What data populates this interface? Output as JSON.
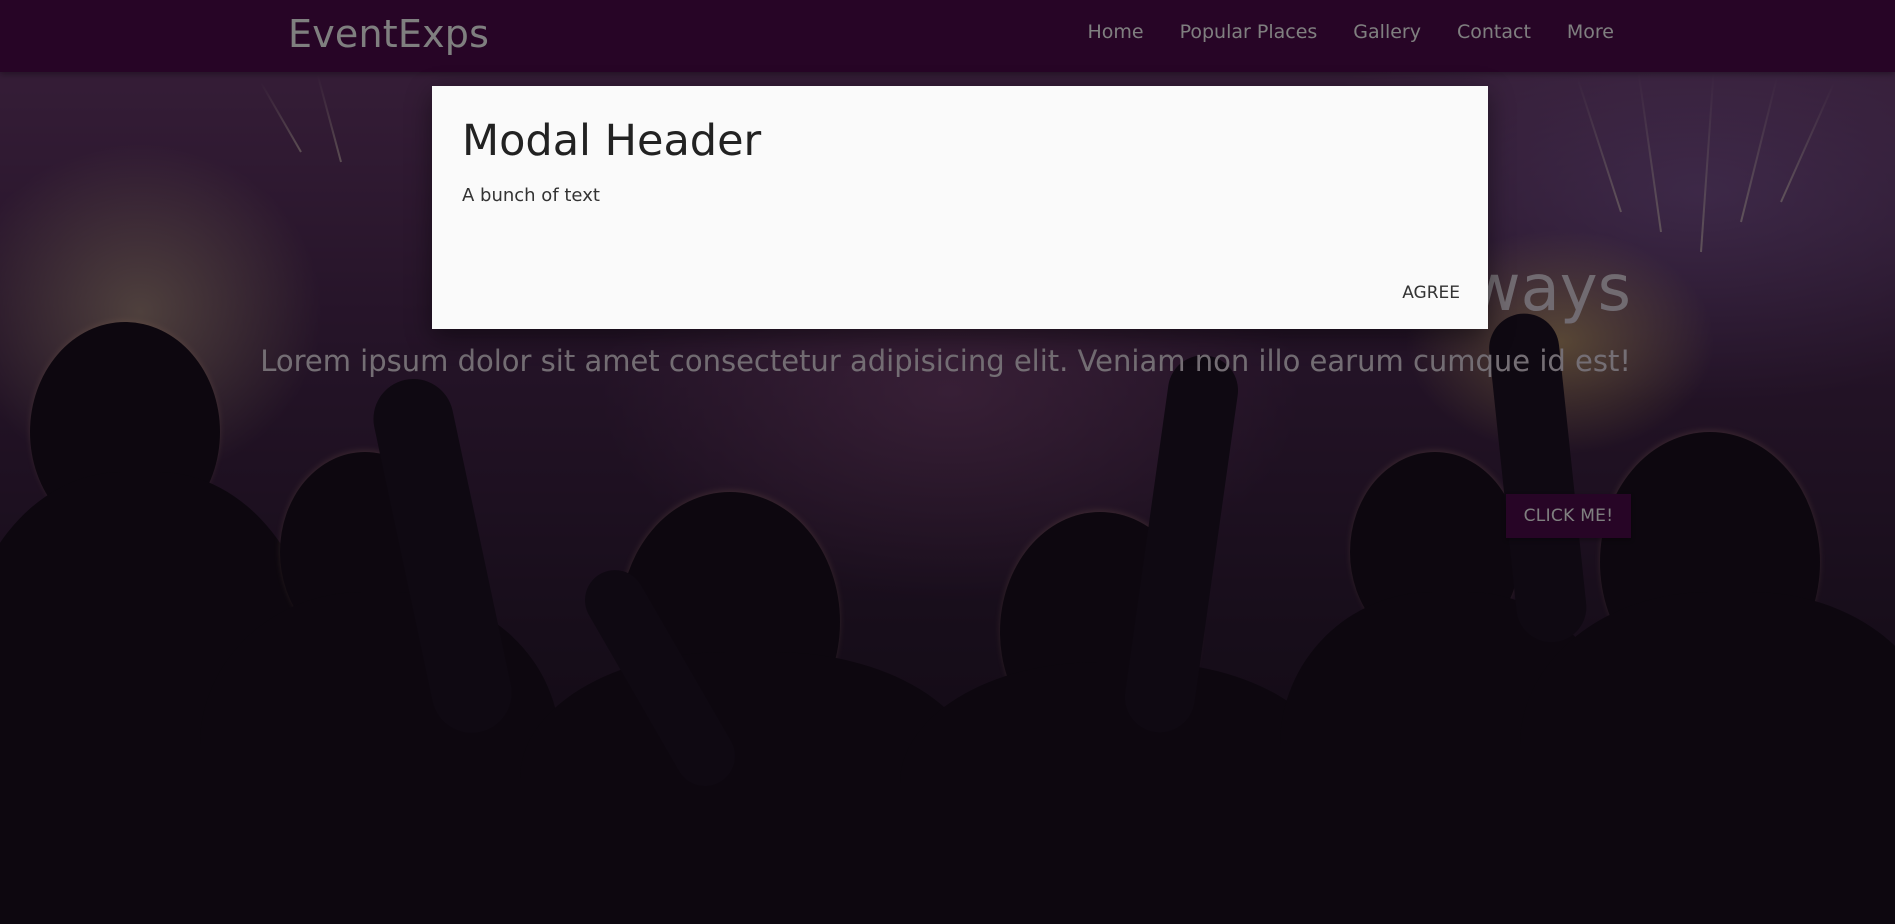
{
  "navbar": {
    "brand": "EventExps",
    "links": [
      {
        "label": "Home"
      },
      {
        "label": "Popular Places"
      },
      {
        "label": "Gallery"
      },
      {
        "label": "Contact"
      },
      {
        "label": "More"
      }
    ]
  },
  "hero": {
    "title_visible": "ways",
    "text": "Lorem ipsum dolor sit amet consectetur adipisicing elit. Veniam non illo earum cumque id est!",
    "button_label": "CLICK ME!"
  },
  "modal": {
    "header": "Modal Header",
    "body": "A bunch of text",
    "agree_label": "AGREE"
  },
  "colors": {
    "navbar_bg": "#4f0a4d",
    "button_bg": "#4f0a4d",
    "modal_bg": "#fafafa",
    "overlay": "rgba(0,0,0,0.5)"
  }
}
